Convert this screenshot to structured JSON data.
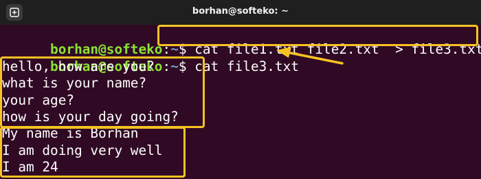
{
  "window": {
    "title": "borhan@softeko: ~"
  },
  "prompt": {
    "user_host": "borhan@softeko",
    "separator": ":",
    "path": "~",
    "symbol": "$ "
  },
  "commands": [
    "cat file1.txt file2.txt  > file3.txt",
    "cat file3.txt"
  ],
  "output": {
    "file1_lines": [
      "hello, how are you?",
      "what is your name?",
      "your age?",
      "how is your day going?"
    ],
    "file2_lines": [
      "My name is Borhan",
      "I am doing very well",
      "I am 24"
    ]
  },
  "colors": {
    "terminal_background": "#300a24",
    "titlebar_background": "#1f1f1f",
    "prompt_user": "#8ae234",
    "prompt_path": "#729fcf",
    "highlight": "#f6c323"
  },
  "icons": {
    "new_tab": "new-tab-icon",
    "annotation_arrow": "arrow-icon"
  }
}
